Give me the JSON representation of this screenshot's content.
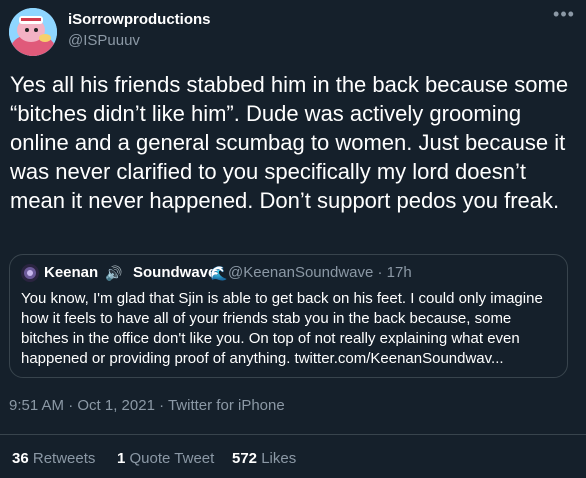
{
  "author": {
    "display_name": "iSorrowproductions",
    "handle": "@ISPuuuv"
  },
  "more_icon": "more-dots-icon",
  "body": "Yes all his friends stabbed him in the back because some “bitches didn’t like him”. Dude was actively grooming online and a general scumbag to women. Just because it was never clarified to you specifically my lord doesn’t mean it never happened. Don’t support pedos you freak.",
  "quoted": {
    "name_part1": "Keenan",
    "emoji1": "🔊",
    "name_part2": "Soundwave",
    "emoji2": "🌊",
    "handle_time": "@KeenanSoundwave · 17h",
    "text": "You know, I'm glad that Sjin is able to get back on his feet. I could only imagine how it feels to have all of your friends stab you in the back because, some bitches in the office don't like you. On top of not really explaining what even happened or providing proof of anything. twitter.com/KeenanSoundwav..."
  },
  "timestamp": "9:51 AM · Oct 1, 2021 · Twitter for iPhone",
  "stats": {
    "retweets_count": "36",
    "retweets_label": "Retweets",
    "quotes_count": "1",
    "quotes_label": "Quote Tweet",
    "likes_count": "572",
    "likes_label": "Likes"
  },
  "colors": {
    "background": "#15202b",
    "text": "#ffffff",
    "secondary": "#8b98a5",
    "border": "#38444d"
  }
}
